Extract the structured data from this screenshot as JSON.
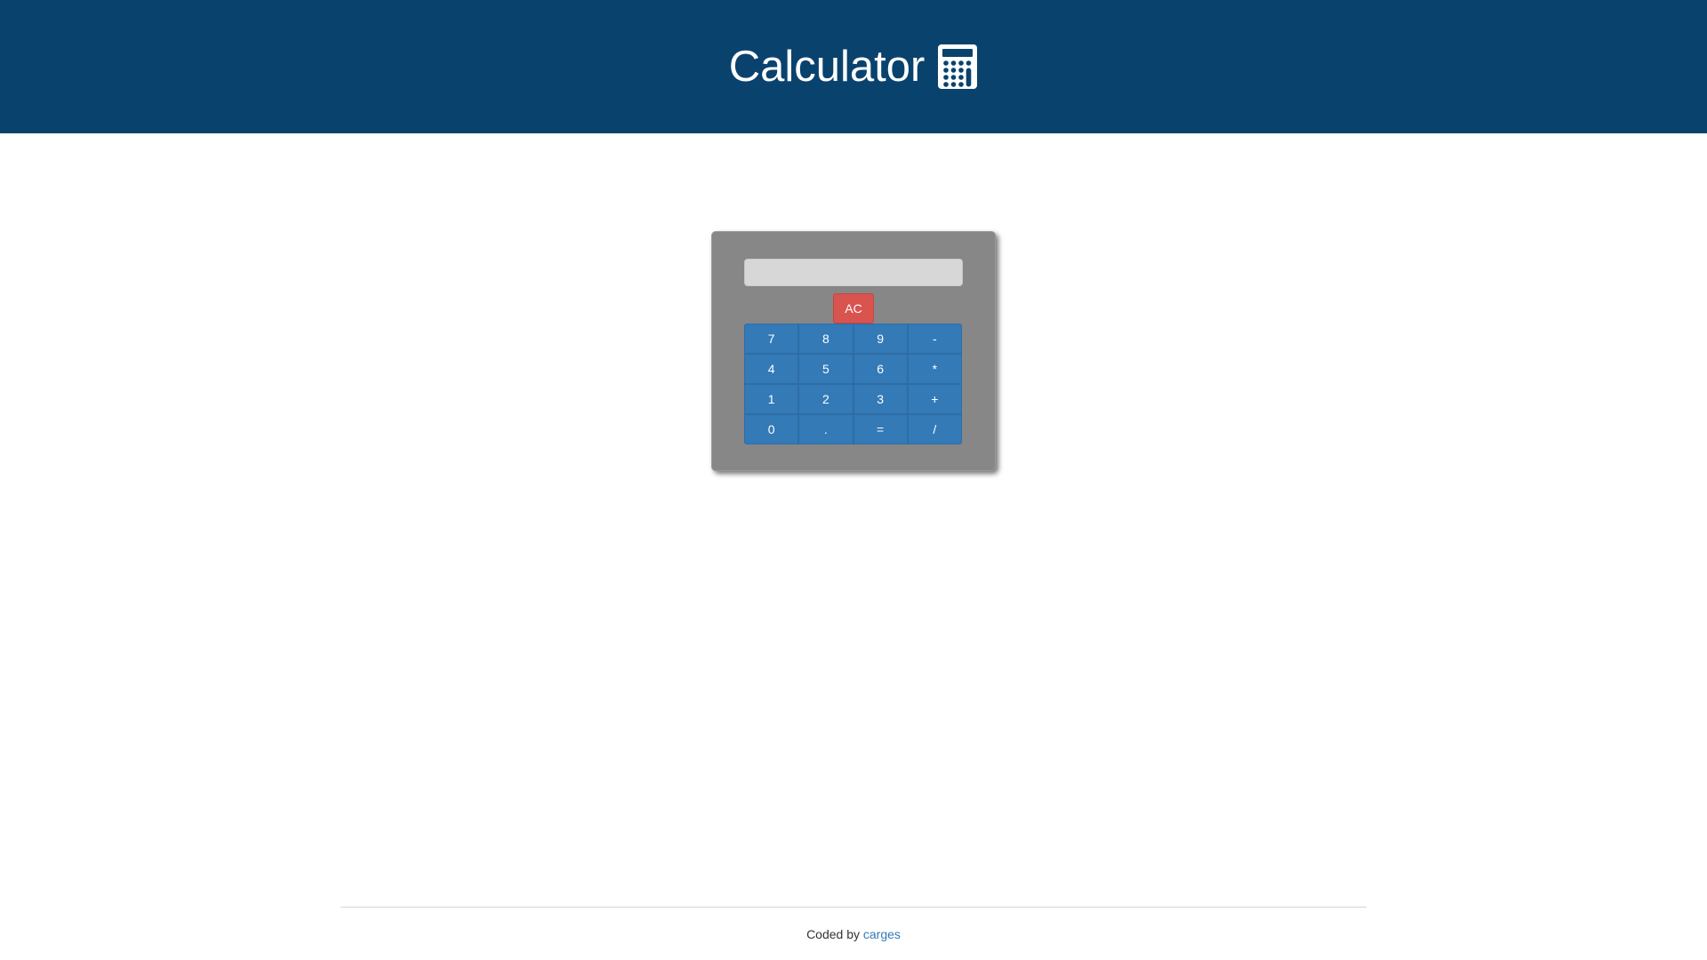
{
  "header": {
    "title": "Calculator",
    "icon": "calculator-icon",
    "background_color": "#0a426e"
  },
  "calculator": {
    "display_value": "",
    "clear_label": "AC",
    "clear_color": "#d9534f",
    "key_color": "#337ab7",
    "keys": [
      [
        "7",
        "8",
        "9",
        "-"
      ],
      [
        "4",
        "5",
        "6",
        "*"
      ],
      [
        "1",
        "2",
        "3",
        "+"
      ],
      [
        "0",
        ".",
        "=",
        "/"
      ]
    ]
  },
  "footer": {
    "prefix": "Coded by",
    "author_link": "carges"
  }
}
